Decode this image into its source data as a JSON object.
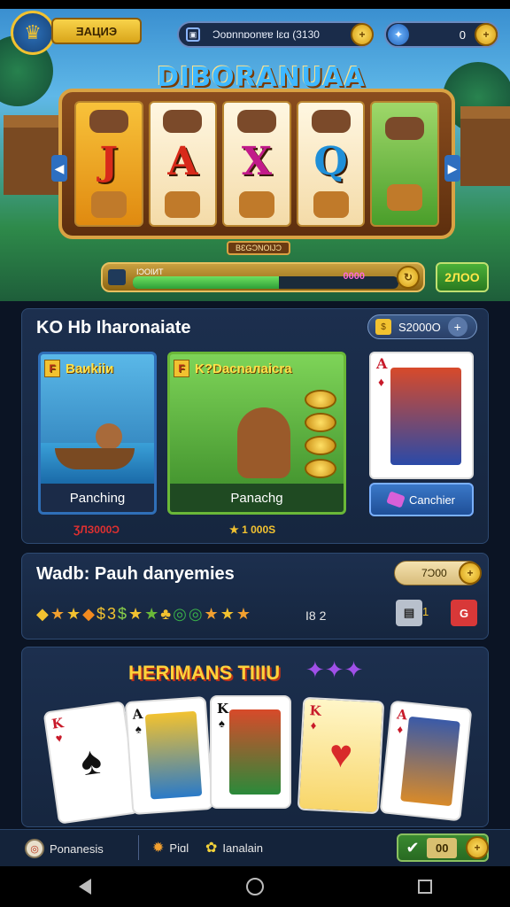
{
  "header": {
    "player_label": "ƎAЦИЭ",
    "coins_text": "Ɔoɒnnɒonɐɐ lɛɑ (3130",
    "gems_value": "0",
    "slot_title": "DIBORANUAA",
    "slot_plate": "BƐGƆNOIJƆ",
    "progress_label": "IƆOIИT",
    "progress_value": "0000",
    "progress_fraction": 0.55,
    "bonus_value": "2ЛОО",
    "reel_letters": [
      "J",
      "A",
      "X",
      "Q",
      ""
    ],
    "reel_letter_colors": [
      "#d82a1a",
      "#d82a1a",
      "#c21a8a",
      "#1f8fd8",
      "#2a8a2a"
    ]
  },
  "panel1": {
    "title": "KO Hb Iharonaiate",
    "price_pill": "S2000O",
    "tile_blue": {
      "badge": "F",
      "title": "Baиkiiи",
      "footer": "Panching"
    },
    "tile_green": {
      "badge": "F",
      "title": "K?Dacnaлaicra",
      "footer": "Panachg"
    },
    "action_label": "Canchier",
    "price_left": "ƷЛЗ000Ɔ",
    "price_right": "1 000S",
    "card_rank": "A"
  },
  "panel2": {
    "title": "Wadb: Pauh danyemies",
    "coin_value": "7Ɔ00",
    "stars": [
      "◆",
      "★",
      "★",
      "◆",
      "$",
      "3",
      "$",
      "★",
      "★",
      "♣",
      "◎",
      "◎",
      "★",
      "★",
      "★"
    ],
    "stars_count": "I8 2",
    "ctrl_number": "1",
    "ctrl_right": "G"
  },
  "panel3": {
    "title": "HERIMANS TIIIU",
    "cards": [
      {
        "rank": "K",
        "suit": "♠",
        "color": "#c81a2a"
      },
      {
        "rank": "A",
        "suit": "♠",
        "color": "#111111"
      },
      {
        "rank": "K",
        "suit": "♠",
        "color": "#111111"
      },
      {
        "rank": "K",
        "suit": "♦",
        "color": "#c81a2a"
      },
      {
        "rank": "A",
        "suit": "♦",
        "color": "#c81a2a"
      }
    ]
  },
  "bottom": {
    "item1": "Ponanesis",
    "item2": "Piɑl",
    "item3": "Ianalain",
    "check_value": "00"
  }
}
